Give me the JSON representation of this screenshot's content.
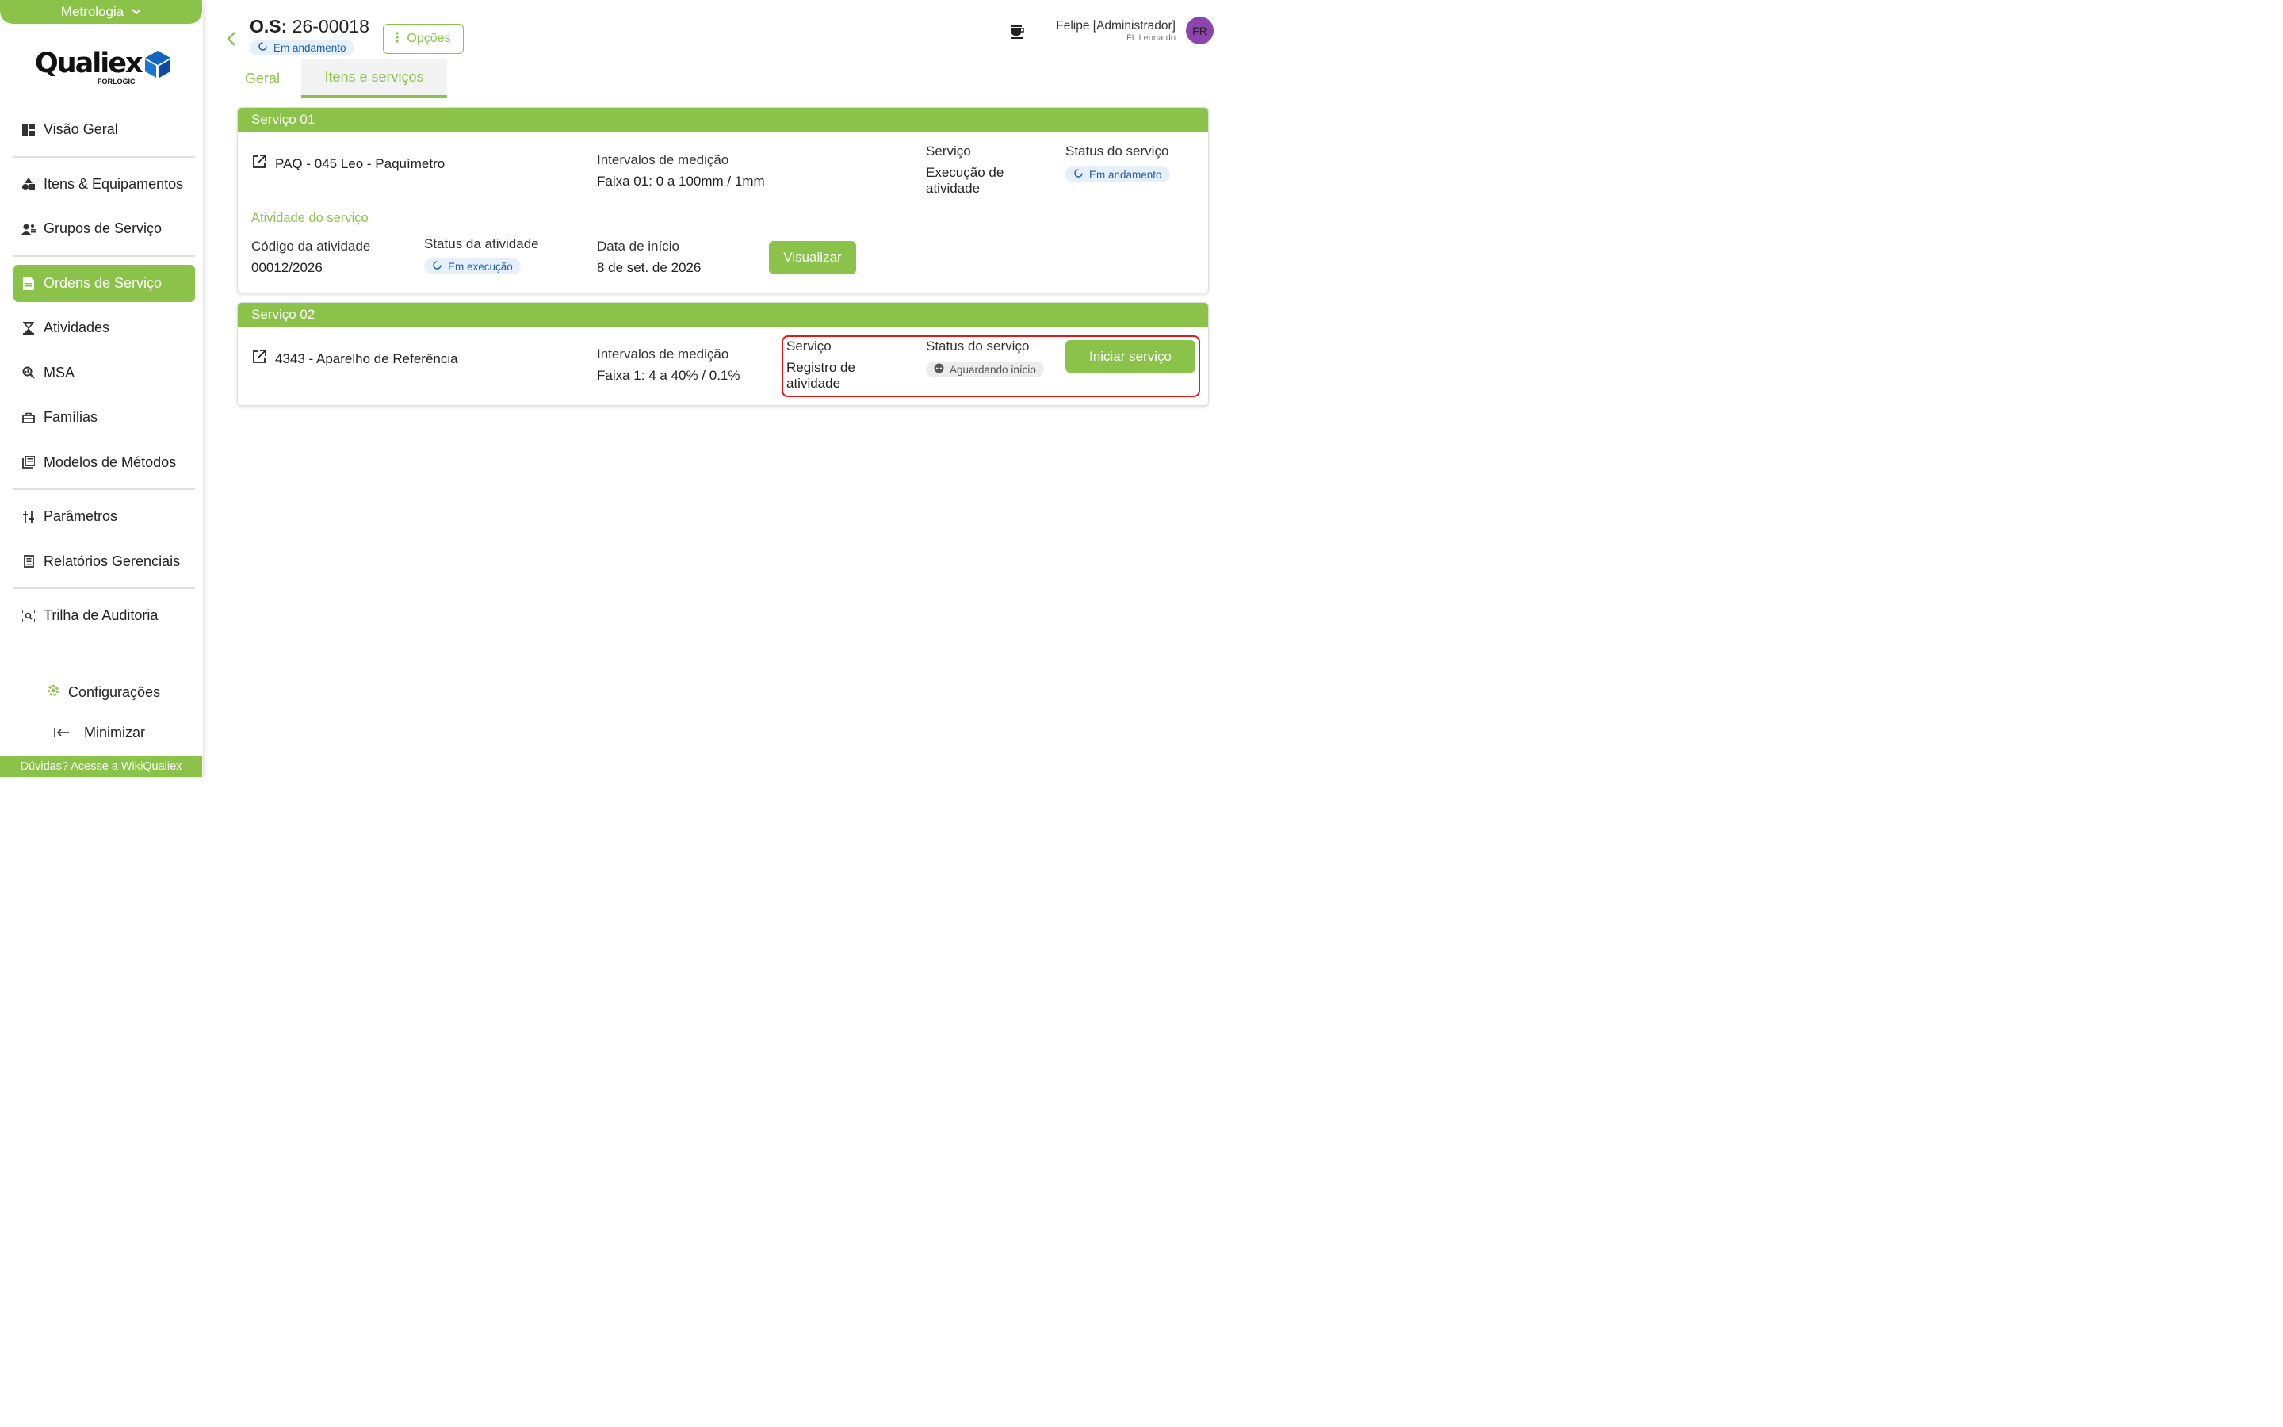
{
  "sidebar": {
    "module": "Metrologia",
    "logo_text": "Qualiex",
    "logo_sub": "FORLOGIC",
    "items": [
      {
        "label": "Visão Geral",
        "icon": "dashboard-icon"
      },
      {
        "label": "Itens & Equipamentos",
        "icon": "shapes-icon"
      },
      {
        "label": "Grupos de Serviço",
        "icon": "group-icon"
      },
      {
        "label": "Ordens de Serviço",
        "icon": "document-icon"
      },
      {
        "label": "Atividades",
        "icon": "hourglass-icon"
      },
      {
        "label": "MSA",
        "icon": "zoom-icon"
      },
      {
        "label": "Famílias",
        "icon": "toolbox-icon"
      },
      {
        "label": "Modelos de Métodos",
        "icon": "library-icon"
      },
      {
        "label": "Parâmetros",
        "icon": "sliders-icon"
      },
      {
        "label": "Relatórios Gerenciais",
        "icon": "report-icon"
      },
      {
        "label": "Trilha de Auditoria",
        "icon": "audit-icon"
      }
    ],
    "settings": "Configurações",
    "minimize": "Minimizar",
    "help_text": "Dúvidas? Acesse a",
    "help_link": "WikiQualiex"
  },
  "header": {
    "os_prefix": "O.S:",
    "os_number": "26-00018",
    "status": "Em andamento",
    "options": "Opções",
    "tabs": [
      "Geral",
      "Itens e serviços"
    ],
    "user_name": "Felipe [Administrador]",
    "user_company": "FL Leonardo",
    "avatar": "FR"
  },
  "services": [
    {
      "title": "Serviço 01",
      "item": "PAQ - 045 Leo - Paquímetro",
      "intervals_label": "Intervalos de medição",
      "intervals_value": "Faixa 01: 0 a 100mm / 1mm",
      "service_label": "Serviço",
      "service_value": "Execução de atividade",
      "status_label": "Status do serviço",
      "status_value": "Em andamento",
      "activity_section": "Atividade do serviço",
      "activity_code_label": "Código da atividade",
      "activity_code": "00012/2026",
      "activity_status_label": "Status da atividade",
      "activity_status": "Em execução",
      "start_label": "Data de início",
      "start_value": "8 de set. de 2026",
      "view_button": "Visualizar"
    },
    {
      "title": "Serviço 02",
      "item": "4343 - Aparelho de Referência",
      "intervals_label": "Intervalos de medição",
      "intervals_value": "Faixa 1: 4 a 40% / 0.1%",
      "service_label": "Serviço",
      "service_value": "Registro de atividade",
      "status_label": "Status do serviço",
      "status_value": "Aguardando início",
      "start_button": "Iniciar serviço"
    }
  ],
  "colors": {
    "primary_green": "#8bc34a",
    "chip_blue": "#1e5fa8",
    "highlight_red": "#e0191b",
    "avatar_purple": "#8e44ad"
  }
}
